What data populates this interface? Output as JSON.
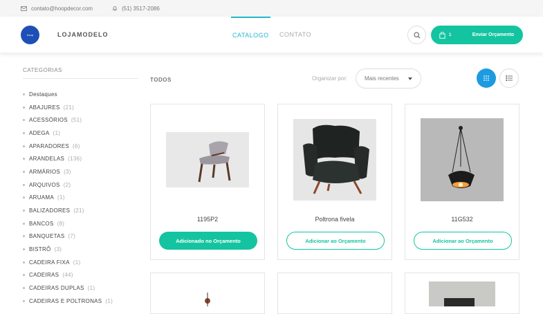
{
  "topbar": {
    "email": "contato@hoopdecor.com",
    "phone": "(51) 3517-2086"
  },
  "header": {
    "logo_text": "hoop",
    "brand": "LOJAMODELO",
    "nav": [
      {
        "label": "CATALOGO",
        "active": true
      },
      {
        "label": "CONTATO",
        "active": false
      }
    ],
    "quote_count": "1",
    "quote_label": "Enviar Orçamento"
  },
  "sidebar": {
    "title": "CATEGORIAS",
    "items": [
      {
        "label": "Destaques",
        "count": ""
      },
      {
        "label": "ABAJURES",
        "count": "(21)"
      },
      {
        "label": "ACESSÓRIOS",
        "count": "(51)"
      },
      {
        "label": "ADEGA",
        "count": "(1)"
      },
      {
        "label": "APARADORES",
        "count": "(6)"
      },
      {
        "label": "ARANDELAS",
        "count": "(136)"
      },
      {
        "label": "ARMÁRIOS",
        "count": "(3)"
      },
      {
        "label": "ARQUIVOS",
        "count": "(2)"
      },
      {
        "label": "ARUAMA",
        "count": "(1)"
      },
      {
        "label": "BALIZADORES",
        "count": "(21)"
      },
      {
        "label": "BANCOS",
        "count": "(8)"
      },
      {
        "label": "BANQUETAS",
        "count": "(7)"
      },
      {
        "label": "BISTRÔ",
        "count": "(3)"
      },
      {
        "label": "CADEIRA FIXA",
        "count": "(1)"
      },
      {
        "label": "CADEIRAS",
        "count": "(44)"
      },
      {
        "label": "CADEIRAS DUPLAS",
        "count": "(1)"
      },
      {
        "label": "CADEIRAS E POLTRONAS",
        "count": "(1)"
      }
    ]
  },
  "toolbar": {
    "section_title": "TODOS",
    "sort_label": "Organizar por:",
    "sort_value": "Mais recentes"
  },
  "products": [
    {
      "name": "1195P2",
      "button": "Adicionado no Orçamento",
      "added": true
    },
    {
      "name": "Poltrona fivela",
      "button": "Adicionar ao Orçamento",
      "added": false
    },
    {
      "name": "11G532",
      "button": "Adicionar ao Orçamento",
      "added": false
    }
  ]
}
